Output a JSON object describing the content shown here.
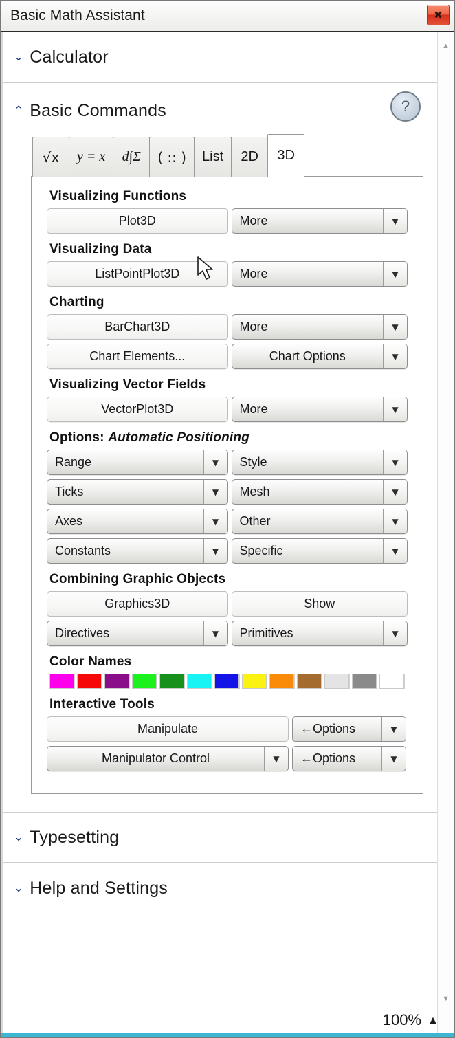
{
  "window": {
    "title": "Basic Math Assistant",
    "close_icon": "close-icon",
    "close_glyph": "✖"
  },
  "scrollbar": {
    "up_glyph": "▲",
    "down_glyph": "▼"
  },
  "sections": {
    "calculator": {
      "label": "Calculator",
      "chevron": "⌄",
      "expanded": false
    },
    "basic_commands": {
      "label": "Basic Commands",
      "chevron": "⌃",
      "expanded": true,
      "help_label": "?"
    },
    "typesetting": {
      "label": "Typesetting",
      "chevron": "⌄",
      "expanded": false
    },
    "help_and_settings": {
      "label": "Help and Settings",
      "chevron": "⌄",
      "expanded": false
    }
  },
  "tabs": [
    {
      "id": "tab-sqrt",
      "label": "√x",
      "selected": false
    },
    {
      "id": "tab-equation",
      "label": "y = x",
      "selected": false
    },
    {
      "id": "tab-calculus",
      "label": "d∫Σ",
      "selected": false
    },
    {
      "id": "tab-matrix",
      "label": "( :: )",
      "selected": false
    },
    {
      "id": "tab-list",
      "label": "List",
      "selected": false
    },
    {
      "id": "tab-2d",
      "label": "2D",
      "selected": false
    },
    {
      "id": "tab-3d",
      "label": "3D",
      "selected": true
    }
  ],
  "groups": {
    "visualizing_functions": {
      "heading": "Visualizing Functions",
      "primary": "Plot3D",
      "dropdown": "More"
    },
    "visualizing_data": {
      "heading": "Visualizing Data",
      "primary": "ListPointPlot3D",
      "dropdown": "More"
    },
    "charting": {
      "heading": "Charting",
      "row1_primary": "BarChart3D",
      "row1_dropdown": "More",
      "row2_primary": "Chart Elements...",
      "row2_dropdown": "Chart Options"
    },
    "vector_fields": {
      "heading": "Visualizing Vector Fields",
      "primary": "VectorPlot3D",
      "dropdown": "More"
    },
    "options": {
      "heading_prefix": "Options: ",
      "heading_emphasis": "Automatic Positioning",
      "items": [
        {
          "left": "Range",
          "right": "Style"
        },
        {
          "left": "Ticks",
          "right": "Mesh"
        },
        {
          "left": "Axes",
          "right": "Other"
        },
        {
          "left": "Constants",
          "right": "Specific"
        }
      ]
    },
    "combining": {
      "heading": "Combining Graphic Objects",
      "row1_left": "Graphics3D",
      "row1_right": "Show",
      "row2_left": "Directives",
      "row2_right": "Primitives"
    },
    "color_names": {
      "heading": "Color Names",
      "swatches": [
        {
          "name": "magenta",
          "hex": "#FF00EC"
        },
        {
          "name": "red",
          "hex": "#F60808"
        },
        {
          "name": "purple",
          "hex": "#8A0D8A"
        },
        {
          "name": "green",
          "hex": "#1DF11D"
        },
        {
          "name": "darkgreen",
          "hex": "#17901C"
        },
        {
          "name": "cyan",
          "hex": "#18F3F3"
        },
        {
          "name": "blue",
          "hex": "#1414E8"
        },
        {
          "name": "yellow",
          "hex": "#FAF312"
        },
        {
          "name": "orange",
          "hex": "#FA8B09"
        },
        {
          "name": "brown",
          "hex": "#A56C30"
        },
        {
          "name": "lightgray",
          "hex": "#E4E4E4"
        },
        {
          "name": "gray",
          "hex": "#8A8A8A"
        },
        {
          "name": "white",
          "hex": "#FFFFFF"
        }
      ]
    },
    "interactive_tools": {
      "heading": "Interactive Tools",
      "row1_primary": "Manipulate",
      "row1_dropdown": "←Options",
      "row2_primary": "Manipulator Control",
      "row2_dropdown": "←Options"
    }
  },
  "statusbar": {
    "zoom": "100%",
    "caret": "▲"
  },
  "arrow_glyph": "▼"
}
